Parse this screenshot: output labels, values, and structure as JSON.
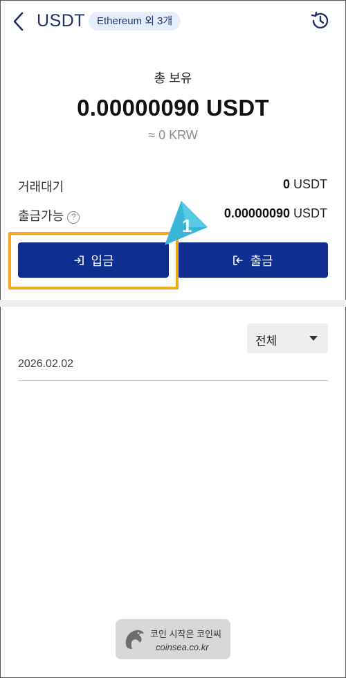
{
  "header": {
    "title": "USDT",
    "network_badge": "Ethereum 외 3개",
    "back_icon": "chevron-left-icon",
    "history_icon": "history-icon"
  },
  "balance": {
    "label": "총 보유",
    "amount": "0.00000090 USDT",
    "krw": "≈ 0 KRW"
  },
  "details": {
    "pending_label": "거래대기",
    "pending_value": "0",
    "pending_unit": " USDT",
    "available_label": "출금가능",
    "available_help": "?",
    "available_value": "0.00000090",
    "available_unit": " USDT"
  },
  "actions": {
    "deposit_label": "입금",
    "withdraw_label": "출금"
  },
  "annotation": {
    "step_number": "1",
    "highlight_color": "#f5a623",
    "marker_color": "#3ab7d8"
  },
  "history": {
    "filter_selected": "전체",
    "date": "2026.02.02"
  },
  "watermark": {
    "line1": "코인 시작은 코인씨",
    "line2": "coinsea.co.kr"
  },
  "colors": {
    "primary": "#0f2e8f",
    "title": "#1f2f6b",
    "badge_bg": "#e6eefb"
  }
}
